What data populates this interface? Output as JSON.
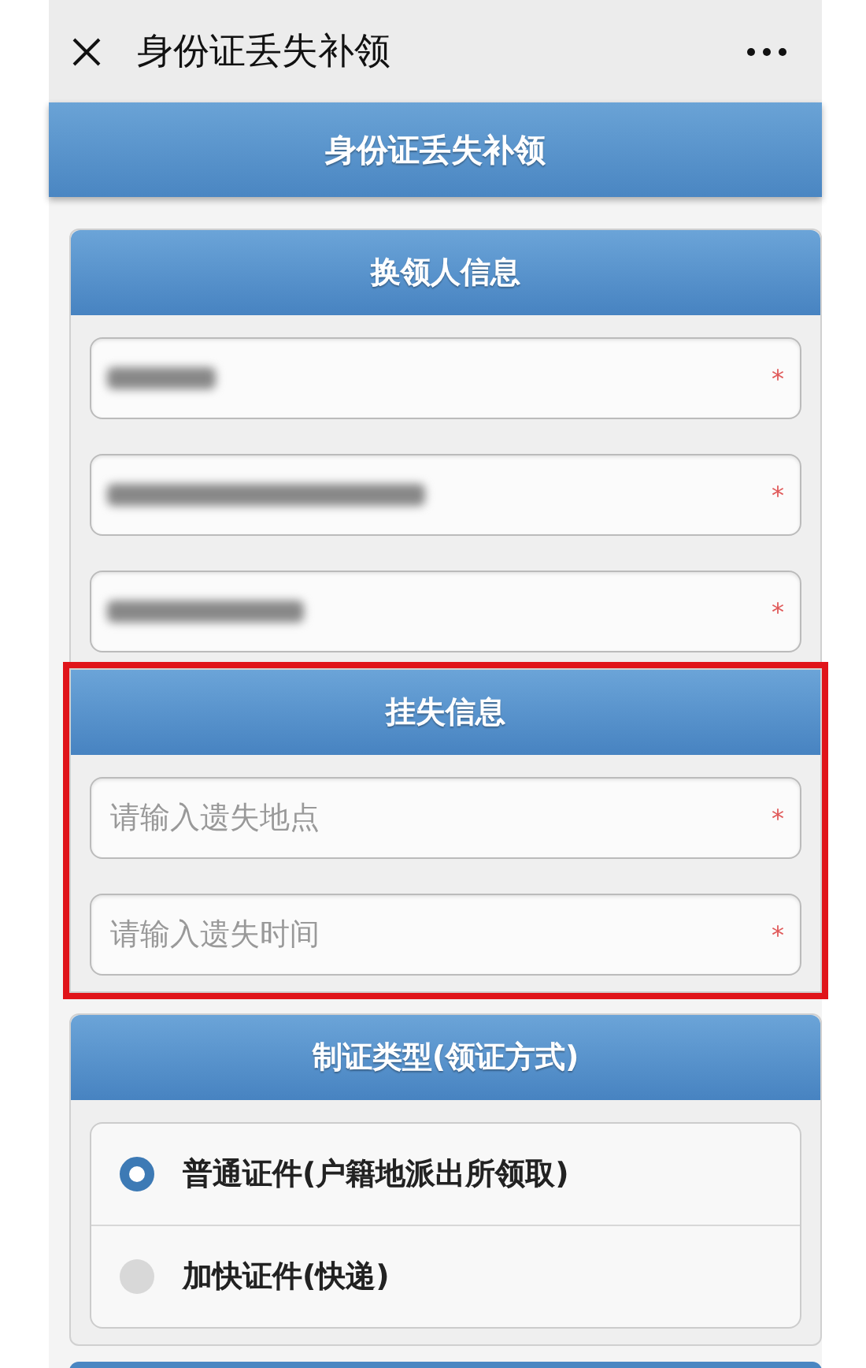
{
  "top_bar": {
    "title": "身份证丢失补领"
  },
  "page_header": {
    "title": "身份证丢失补领"
  },
  "sections": [
    {
      "title": "换领人信息",
      "highlighted": false,
      "fields": [
        {
          "kind": "redacted",
          "required_mark": "*"
        },
        {
          "kind": "redacted",
          "required_mark": "*"
        },
        {
          "kind": "redacted",
          "required_mark": "*"
        }
      ]
    },
    {
      "title": "挂失信息",
      "highlighted": true,
      "fields": [
        {
          "kind": "input",
          "placeholder": "请输入遗失地点",
          "required_mark": "*"
        },
        {
          "kind": "input",
          "placeholder": "请输入遗失时间",
          "required_mark": "*"
        }
      ]
    },
    {
      "title": "制证类型(领证方式)",
      "highlighted": false,
      "options": [
        {
          "label": "普通证件(户籍地派出所领取)",
          "selected": true
        },
        {
          "label": "加快证件(快递)",
          "selected": false
        }
      ]
    }
  ]
}
